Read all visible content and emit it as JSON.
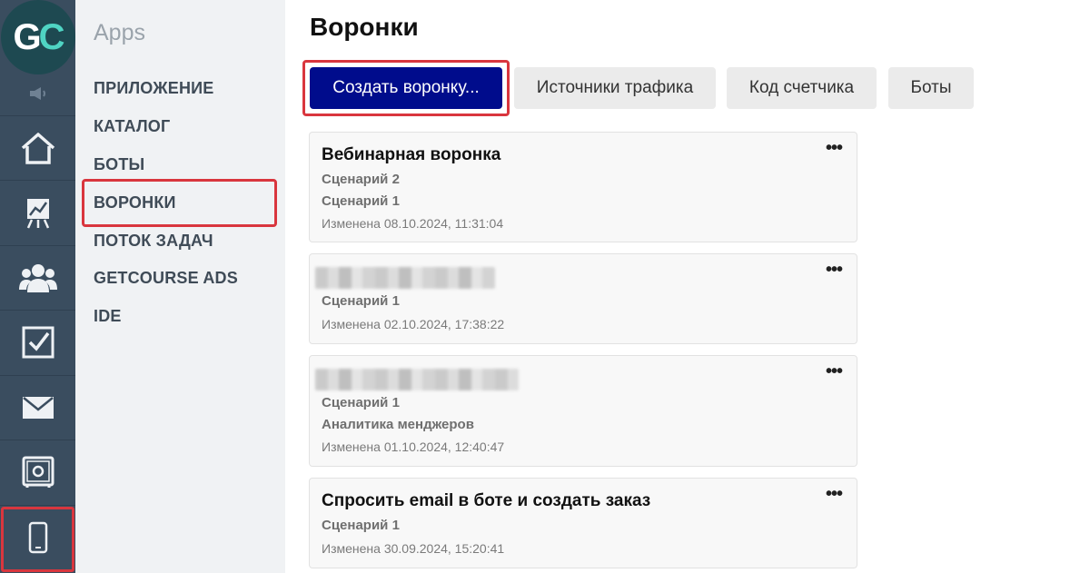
{
  "logo": {
    "g": "G",
    "c": "C"
  },
  "rail": {
    "icons": [
      "speaker-icon",
      "home-icon",
      "chart-icon",
      "users-icon",
      "checkbox-icon",
      "mail-icon",
      "safe-icon",
      "mobile-icon"
    ],
    "color": "#3a4d5f"
  },
  "apps_menu": {
    "title": "Apps",
    "items": [
      "ПРИЛОЖЕНИЕ",
      "КАТАЛОГ",
      "БОТЫ",
      "ВОРОНКИ",
      "ПОТОК ЗАДАЧ",
      "GETCOURSE ADS",
      "IDE"
    ]
  },
  "page": {
    "title": "Воронки"
  },
  "toolbar": {
    "create_label": "Создать воронку...",
    "traffic_label": "Источники трафика",
    "counter_label": "Код счетчика",
    "bots_label": "Боты"
  },
  "funnels": [
    {
      "title": "Вебинарная воронка",
      "scenarios": [
        "Сценарий 2",
        "Сценарий 1"
      ],
      "modified": "Изменена 08.10.2024, 11:31:04"
    },
    {
      "title": "",
      "scenarios": [
        "Сценарий 1"
      ],
      "modified": "Изменена 02.10.2024, 17:38:22"
    },
    {
      "title": "",
      "scenarios": [
        "Сценарий 1",
        "Аналитика менджеров"
      ],
      "modified": "Изменена 01.10.2024, 12:40:47"
    },
    {
      "title": "Спросить email в боте и создать заказ",
      "scenarios": [
        "Сценарий 1"
      ],
      "modified": "Изменена 30.09.2024, 15:20:41"
    }
  ],
  "menu_glyph": "•••",
  "colors": {
    "primary_button": "#000c8c",
    "highlight": "#d9363e",
    "rail": "#3a4d5f"
  }
}
